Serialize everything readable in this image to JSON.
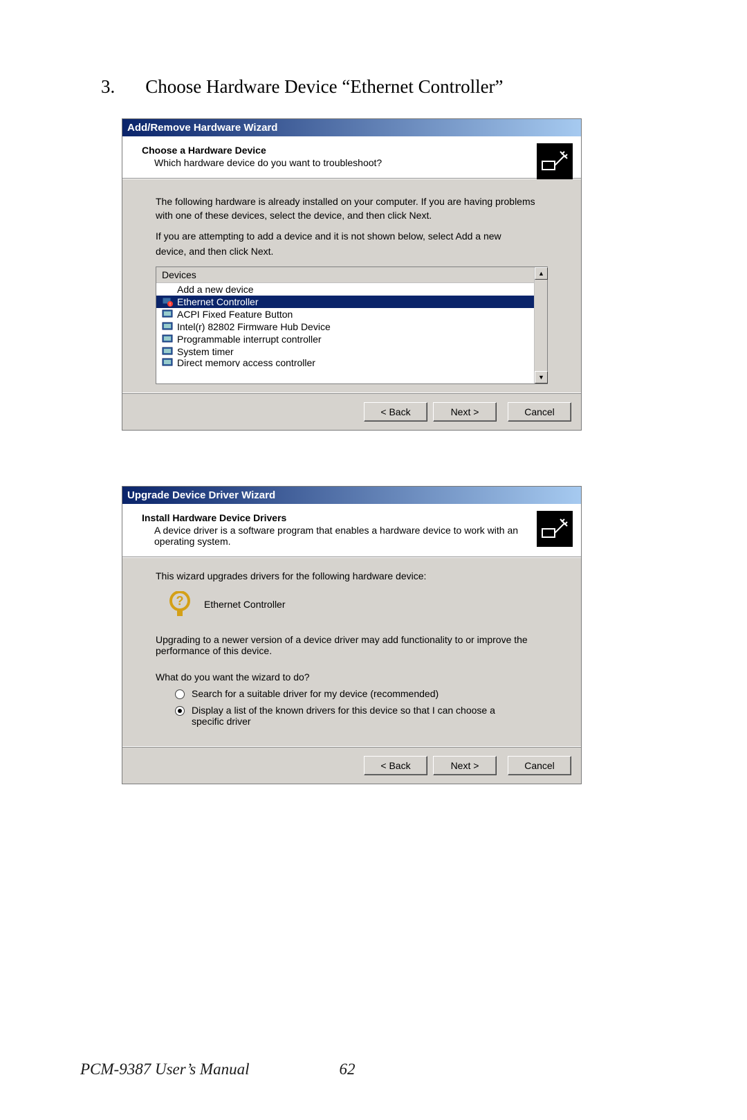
{
  "instruction": {
    "number": "3.",
    "text": "Choose Hardware Device “Ethernet Controller”"
  },
  "dialog1": {
    "title": "Add/Remove Hardware Wizard",
    "heading": "Choose a Hardware Device",
    "subheading": "Which hardware device do you want to troubleshoot?",
    "para1a": "The following hardware is already installed on your computer. If you are having problems",
    "para1b": "with one of these devices, select the device, and then click Next.",
    "para2a": "If you are attempting to add a device and it is not shown below, select Add a new",
    "para2b": "device, and then click Next.",
    "list_header": "Devices",
    "items": {
      "0": "Add a new device",
      "1": "Ethernet Controller",
      "2": "ACPI Fixed Feature Button",
      "3": "Intel(r) 82802 Firmware Hub Device",
      "4": "Programmable interrupt controller",
      "5": "System timer",
      "6": "Direct memory access controller"
    },
    "buttons": {
      "back": "< Back",
      "next": "Next >",
      "cancel": "Cancel"
    }
  },
  "dialog2": {
    "title": "Upgrade Device Driver Wizard",
    "heading": "Install Hardware Device Drivers",
    "subheading": "A device driver is a software program that enables a hardware device to work with an operating system.",
    "line1": "This wizard upgrades drivers for the following hardware device:",
    "device_name": "Ethernet Controller",
    "line2": "Upgrading to a newer version of a device driver may add functionality to or improve the performance of this device.",
    "question": "What do you want the wizard to do?",
    "opt1": "Search for a suitable driver for my device (recommended)",
    "opt2": "Display a list of the known drivers for this device so that I can choose a specific driver",
    "buttons": {
      "back": "< Back",
      "next": "Next >",
      "cancel": "Cancel"
    }
  },
  "footer": {
    "manual": "PCM-9387 User’s Manual",
    "page": "62"
  }
}
